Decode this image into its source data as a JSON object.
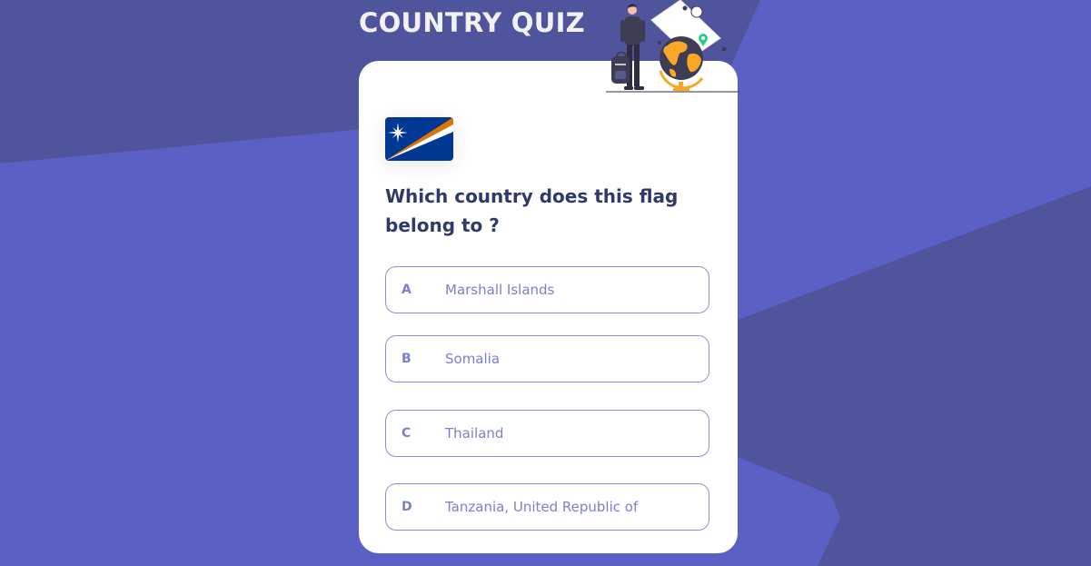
{
  "app": {
    "title": "COUNTRY QUIZ"
  },
  "question": {
    "text": "Which country does this flag belong to ?",
    "flag_icon": "marshall-islands-flag"
  },
  "answers": [
    {
      "letter": "A",
      "text": "Marshall Islands"
    },
    {
      "letter": "B",
      "text": "Somalia"
    },
    {
      "letter": "C",
      "text": "Thailand"
    },
    {
      "letter": "D",
      "text": "Tanzania, United Republic of"
    }
  ],
  "colors": {
    "background": "#5b61c4",
    "background_shade": "#50549c",
    "title": "#f2f2f2",
    "question": "#2f3a6b",
    "answer_border": "#8c8fd6",
    "answer_text": "#7a7fcf",
    "accent_orange": "#f9a826"
  }
}
